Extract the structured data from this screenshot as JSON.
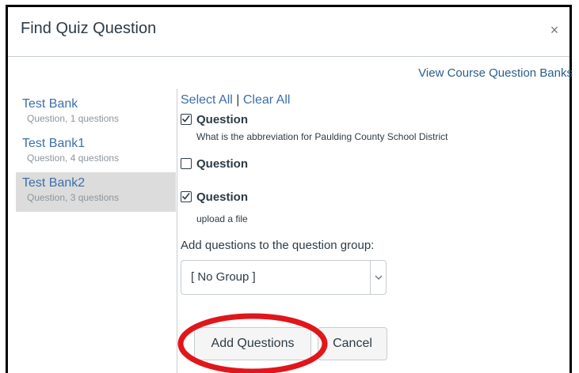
{
  "dialog": {
    "title": "Find Quiz Question",
    "close_icon": "close-icon",
    "close_glyph": "×"
  },
  "header": {
    "view_banks_link": "View Course Question Banks"
  },
  "banks": [
    {
      "name": "Test Bank",
      "meta": "Question, 1 questions",
      "selected": false
    },
    {
      "name": "Test Bank1",
      "meta": "Question, 4 questions",
      "selected": false
    },
    {
      "name": "Test Bank2",
      "meta": "Question, 3 questions",
      "selected": true
    }
  ],
  "selection": {
    "select_all": "Select All",
    "separator": "|",
    "clear_all": "Clear All"
  },
  "questions": [
    {
      "label": "Question",
      "text": "What is the abbreviation for Paulding County School District",
      "checked": true
    },
    {
      "label": "Question",
      "text": "",
      "checked": false
    },
    {
      "label": "Question",
      "text": "upload a file",
      "checked": true
    }
  ],
  "group": {
    "label": "Add questions to the question group:",
    "selected_value": "[ No Group ]",
    "dropdown_icon": "chevron-down-icon"
  },
  "buttons": {
    "add_label": "Add Questions",
    "cancel_label": "Cancel"
  },
  "annotation": {
    "highlight_color": "#e0161b",
    "highlight_icon": "highlight-ellipse-icon"
  },
  "colors": {
    "link": "#3c6fa8",
    "selected_bank_bg": "#dcdcdc",
    "border": "#000000"
  }
}
